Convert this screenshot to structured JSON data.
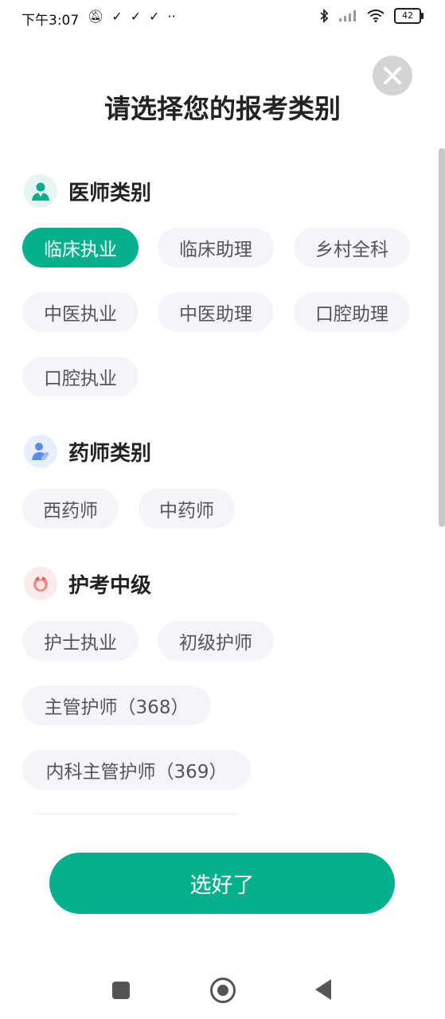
{
  "status_bar": {
    "time": "下午3:07",
    "battery": "42"
  },
  "dialog": {
    "title": "请选择您的报考类别"
  },
  "sections": [
    {
      "title": "医师类别",
      "icon": "doctor-icon",
      "options": [
        "临床执业",
        "临床助理",
        "乡村全科",
        "中医执业",
        "中医助理",
        "口腔助理",
        "口腔执业"
      ],
      "selected": "临床执业"
    },
    {
      "title": "药师类别",
      "icon": "pharmacist-icon",
      "options": [
        "西药师",
        "中药师"
      ]
    },
    {
      "title": "护考中级",
      "icon": "nurse-icon",
      "options": [
        "护士执业",
        "初级护师",
        "主管护师（368）",
        "内科主管护师（369）"
      ]
    }
  ],
  "confirm_label": "选好了",
  "colors": {
    "accent": "#07b08c",
    "chip_bg": "#f3f5f8"
  }
}
